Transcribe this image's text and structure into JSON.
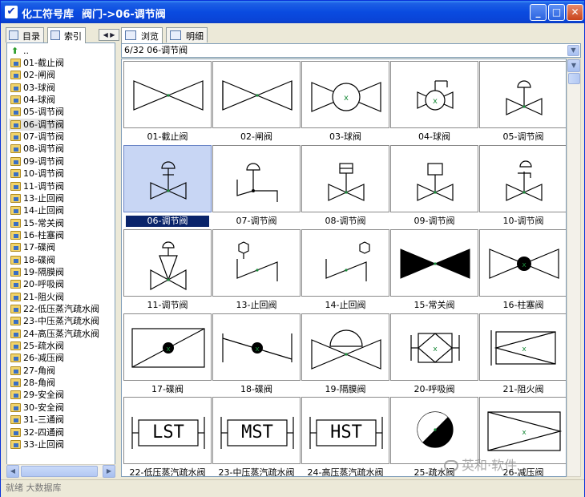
{
  "window": {
    "app_title": "化工符号库",
    "path_title": "阀门->06-调节阀",
    "minimize_label": "_",
    "maximize_label": "□",
    "close_label": "✕"
  },
  "left_tabs": [
    {
      "label": "目录",
      "icon": "list-icon"
    },
    {
      "label": "索引",
      "icon": "index-icon"
    }
  ],
  "tree": {
    "up_label": "..",
    "items": [
      "01-截止阀",
      "02-闸阀",
      "03-球阀",
      "04-球阀",
      "05-调节阀",
      "06-调节阀",
      "07-调节阀",
      "08-调节阀",
      "09-调节阀",
      "10-调节阀",
      "11-调节阀",
      "13-止回阀",
      "14-止回阀",
      "15-常关阀",
      "16-柱塞阀",
      "17-碟阀",
      "18-碟阀",
      "19-隔膜阀",
      "20-呼吸阀",
      "21-阻火阀",
      "22-低压蒸汽疏水阀",
      "23-中压蒸汽疏水阀",
      "24-高压蒸汽疏水阀",
      "25-疏水阀",
      "26-减压阀",
      "27-角阀",
      "28-角阀",
      "29-安全阀",
      "30-安全阀",
      "31-三通阀",
      "32-四通阀",
      "33-止回阀"
    ],
    "selected_index": 5
  },
  "right_tabs": [
    {
      "label": "浏览",
      "icon": "grid-view-icon"
    },
    {
      "label": "明细",
      "icon": "detail-view-icon"
    }
  ],
  "path_bar": "6/32 06-调节阀",
  "symbols": [
    "01-截止阀",
    "02-闸阀",
    "03-球阀",
    "04-球阀",
    "05-调节阀",
    "06-调节阀",
    "07-调节阀",
    "08-调节阀",
    "09-调节阀",
    "10-调节阀",
    "11-调节阀",
    "13-止回阀",
    "14-止回阀",
    "15-常关阀",
    "16-柱塞阀",
    "17-碟阀",
    "18-碟阀",
    "19-隔膜阀",
    "20-呼吸阀",
    "21-阻火阀",
    "22-低压蒸汽疏水阀",
    "23-中压蒸汽疏水阀",
    "24-高压蒸汽疏水阀",
    "25-疏水阀",
    "26-减压阀"
  ],
  "selected_symbol": 5,
  "symbol_text": {
    "low": "LST",
    "mid": "MST",
    "high": "HST"
  },
  "status_text": "就绪 大数据库",
  "watermark": "英和·软件"
}
